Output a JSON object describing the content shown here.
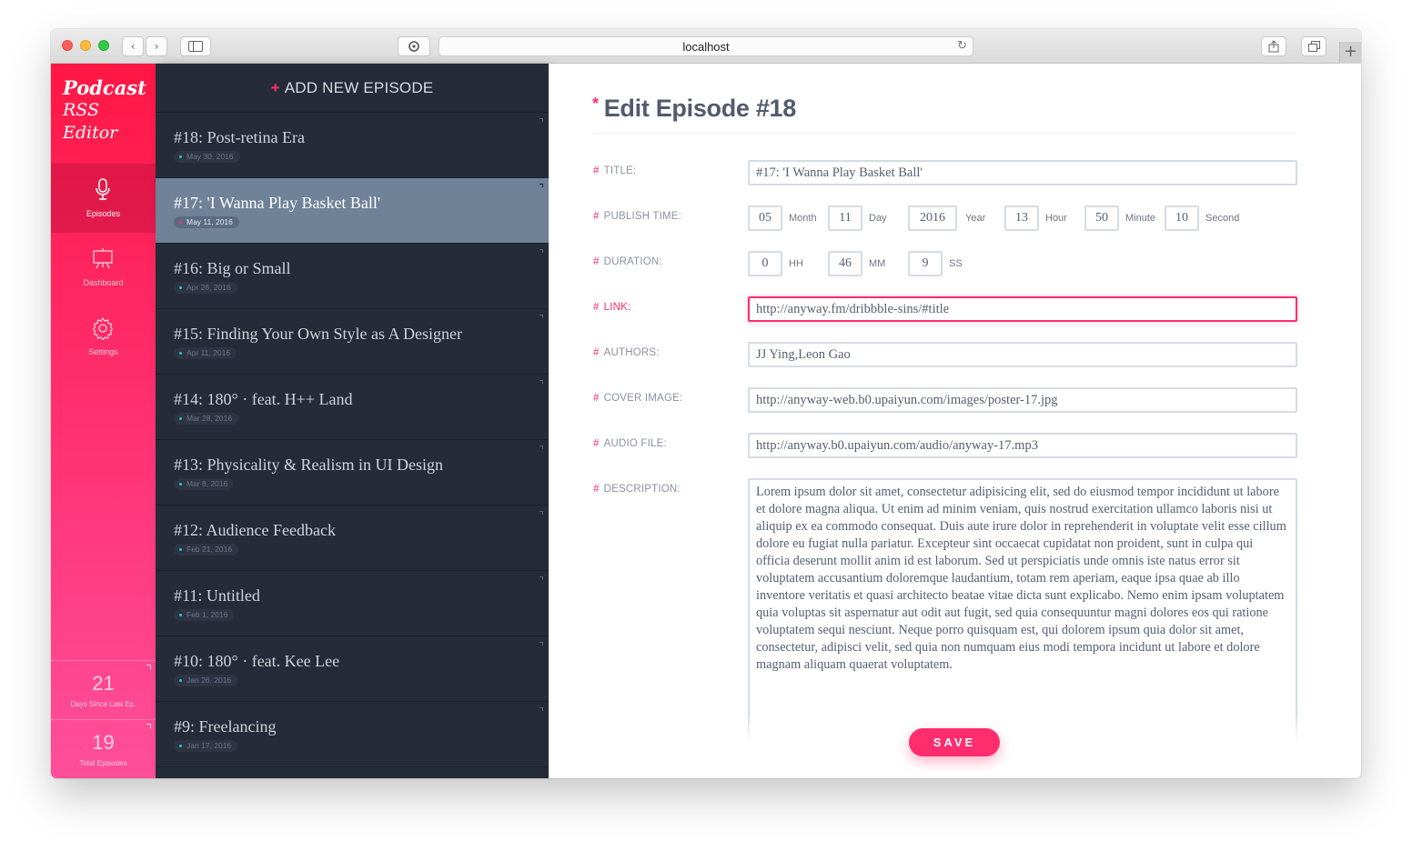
{
  "browser": {
    "url": "localhost",
    "back_icon": "‹",
    "forward_icon": "›",
    "reload_icon": "↻",
    "new_tab_icon": "+"
  },
  "brand": {
    "line1": "Podcast",
    "line2": "RSS",
    "line3": "Editor"
  },
  "nav": [
    {
      "label": "Episodes",
      "icon": "microphone-icon"
    },
    {
      "label": "Dashboard",
      "icon": "presentation-icon"
    },
    {
      "label": "Settings",
      "icon": "gear-icon"
    }
  ],
  "stats": [
    {
      "value": "21",
      "caption": "Days Since Last Ep."
    },
    {
      "value": "19",
      "caption": "Total Episodes"
    }
  ],
  "list": {
    "add_label": "ADD NEW EPISODE",
    "add_icon": "+",
    "episodes": [
      {
        "title": "#18: Post-retina Era",
        "date": "May 30, 2016"
      },
      {
        "title": "#17: 'I Wanna Play Basket Ball'",
        "date": "May 11, 2016"
      },
      {
        "title": "#16: Big or Small",
        "date": "Apr 26, 2016"
      },
      {
        "title": "#15: Finding Your Own Style as A Designer",
        "date": "Apr 11, 2016"
      },
      {
        "title": "#14: 180° · feat. H++ Land",
        "date": "Mar 28, 2016"
      },
      {
        "title": "#13: Physicality & Realism in UI Design",
        "date": "Mar 8, 2016"
      },
      {
        "title": "#12: Audience Feedback",
        "date": "Feb 21, 2016"
      },
      {
        "title": "#11: Untitled",
        "date": "Feb 1, 2016"
      },
      {
        "title": "#10: 180° · feat. Kee Lee",
        "date": "Jan 26, 2016"
      },
      {
        "title": "#9: Freelancing",
        "date": "Jan 17, 2016"
      }
    ]
  },
  "form": {
    "heading": "Edit Episode #18",
    "heading_icon": "*",
    "hash": "#",
    "labels": {
      "title": "TITLE:",
      "publish": "PUBLISH TIME:",
      "duration": "DURATION:",
      "link": "LINK:",
      "authors": "AUTHORS:",
      "cover": "COVER IMAGE:",
      "audio": "AUDIO FILE:",
      "description": "DESCRIPTION:"
    },
    "title_value": "#17: 'I Wanna Play Basket Ball'",
    "publish": {
      "month": "05",
      "month_unit": "Month",
      "day": "11",
      "day_unit": "Day",
      "year": "2016",
      "year_unit": "Year",
      "hour": "13",
      "hour_unit": "Hour",
      "minute": "50",
      "minute_unit": "Minute",
      "second": "10",
      "second_unit": "Second"
    },
    "duration": {
      "hh": "0",
      "hh_unit": "HH",
      "mm": "46",
      "mm_unit": "MM",
      "ss": "9",
      "ss_unit": "SS"
    },
    "link_value": "http://anyway.fm/dribbble-sins/#title",
    "authors_value": "JJ Ying,Leon Gao",
    "cover_value": "http://anyway-web.b0.upaiyun.com/images/poster-17.jpg",
    "audio_value": "http://anyway.b0.upaiyun.com/audio/anyway-17.mp3",
    "description_value": "Lorem ipsum dolor sit amet, consectetur adipisicing elit, sed do eiusmod tempor incididunt ut labore et dolore magna aliqua. Ut enim ad minim veniam, quis nostrud exercitation ullamco laboris nisi ut aliquip ex ea commodo consequat. Duis aute irure dolor in reprehenderit in voluptate velit esse cillum dolore eu fugiat nulla pariatur. Excepteur sint occaecat cupidatat non proident, sunt in culpa qui officia deserunt mollit anim id est laborum. Sed ut perspiciatis unde omnis iste natus error sit voluptatem accusantium doloremque laudantium, totam rem aperiam, eaque ipsa quae ab illo inventore veritatis et quasi architecto beatae vitae dicta sunt explicabo. Nemo enim ipsam voluptatem quia voluptas sit aspernatur aut odit aut fugit, sed quia consequuntur magni dolores eos qui ratione voluptatem sequi nesciunt. Neque porro quisquam est, qui dolorem ipsum quia dolor sit amet, consectetur, adipisci velit, sed quia non numquam eius modi tempora incidunt ut labore et dolore magnam aliquam quaerat voluptatem.",
    "save_label": "SAVE"
  },
  "colors": {
    "accent": "#ff2d6e",
    "list_bg": "#252b38",
    "list_active": "#6f8298",
    "date_dot": "#1ec6d8"
  }
}
